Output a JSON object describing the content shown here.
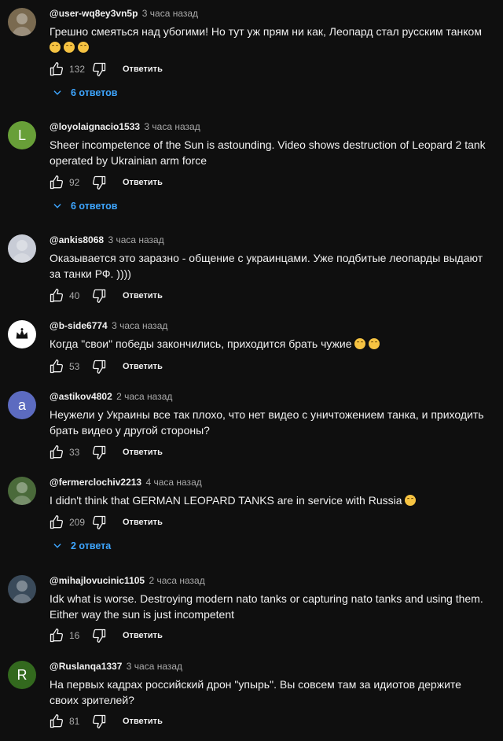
{
  "comments": [
    {
      "handle": "@user-wq8ey3vn5p",
      "time": "3 часа назад",
      "text": "Грешно смеяться над убогими! Но тут уж прям ни как, Леопард стал русским танком",
      "emoji": 3,
      "likes": "132",
      "reply_label": "Ответить",
      "replies": "6 ответов",
      "avatar": {
        "kind": "photo",
        "color": "#7a6a50"
      }
    },
    {
      "handle": "@loyolaignacio1533",
      "time": "3 часа назад",
      "text": "Sheer incompetence of the Sun is astounding. Video shows destruction of Leopard 2 tank operated by Ukrainian arm force",
      "emoji": 0,
      "likes": "92",
      "reply_label": "Ответить",
      "replies": "6 ответов",
      "avatar": {
        "kind": "letter",
        "letter": "L",
        "color": "#689f38"
      }
    },
    {
      "handle": "@ankis8068",
      "time": "3 часа назад",
      "text": "Оказывается это заразно - общение с украинцами. Уже подбитые леопарды выдают за танки РФ. ))))",
      "emoji": 0,
      "likes": "40",
      "reply_label": "Ответить",
      "replies": "",
      "avatar": {
        "kind": "photo",
        "color": "#c8ccd6"
      }
    },
    {
      "handle": "@b-side6774",
      "time": "3 часа назад",
      "text": "Когда \"свои\" победы закончились, приходится брать чужие",
      "emoji": 2,
      "likes": "53",
      "reply_label": "Ответить",
      "replies": "",
      "avatar": {
        "kind": "crown",
        "color": "#ffffff"
      }
    },
    {
      "handle": "@astikov4802",
      "time": "2 часа назад",
      "text": "Неужели у Украины все так плохо, что нет видео с уничтожением танка, и приходить брать видео у другой стороны?",
      "emoji": 0,
      "likes": "33",
      "reply_label": "Ответить",
      "replies": "",
      "avatar": {
        "kind": "letter",
        "letter": "a",
        "color": "#5c6bc0"
      }
    },
    {
      "handle": "@fermerclochiv2213",
      "time": "4 часа назад",
      "text": "I didn't think that GERMAN LEOPARD TANKS are in service with Russia",
      "emoji": 1,
      "likes": "209",
      "reply_label": "Ответить",
      "replies": "2 ответа",
      "avatar": {
        "kind": "photo",
        "color": "#4a6a3a"
      }
    },
    {
      "handle": "@mihajlovucinic1105",
      "time": "2 часа назад",
      "text": "Idk what is worse. Destroying modern nato tanks or capturing nato tanks and using them. Either way the sun is just incompetent",
      "emoji": 0,
      "likes": "16",
      "reply_label": "Ответить",
      "replies": "",
      "avatar": {
        "kind": "photo",
        "color": "#3a4a5a"
      }
    },
    {
      "handle": "@Ruslanqa1337",
      "time": "3 часа назад",
      "text": "На первых кадрах российский дрон \"упырь\". Вы совсем там за идиотов держите своих зрителей?",
      "emoji": 0,
      "likes": "81",
      "reply_label": "Ответить",
      "replies": "",
      "avatar": {
        "kind": "letter",
        "letter": "R",
        "color": "#33691e"
      }
    }
  ]
}
